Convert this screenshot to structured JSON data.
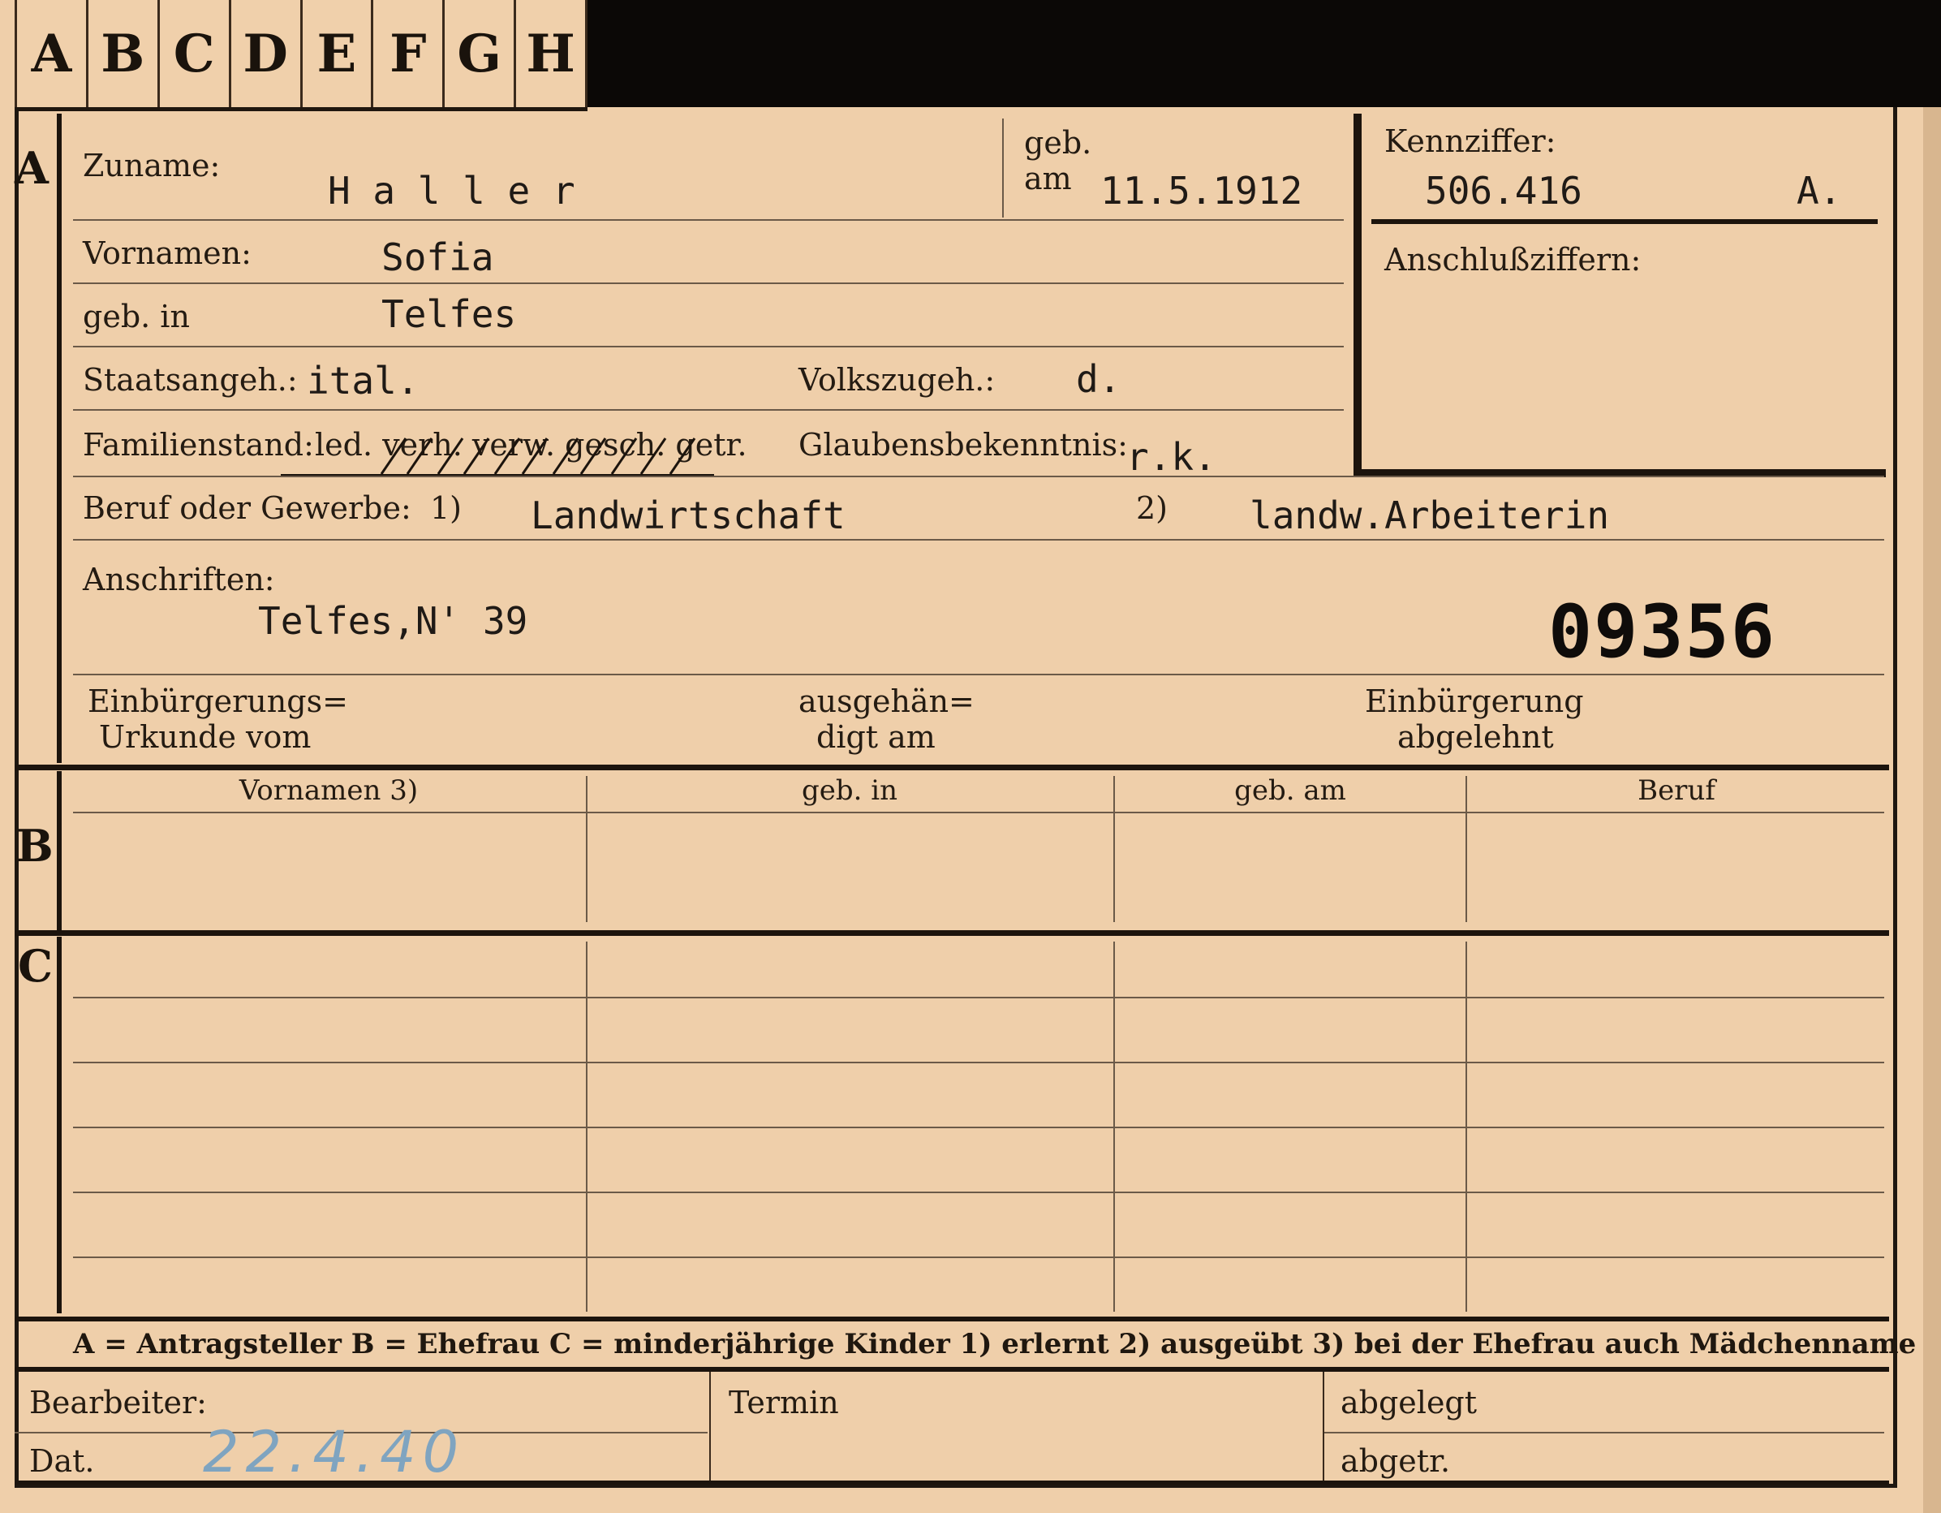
{
  "tabs": [
    "A",
    "B",
    "C",
    "D",
    "E",
    "F",
    "G",
    "H"
  ],
  "section_a": {
    "marker": "A",
    "zuname_label": "Zuname:",
    "zuname_value": "H a l l e r",
    "geb_label": "geb.",
    "am_label": "am",
    "geb_am_value": "11.5.1912",
    "kennziffer_label": "Kennziffer:",
    "kennziffer_value": "506.416",
    "kennziffer_suffix": "A.",
    "anschluss_label": "Anschlußziffern:",
    "vornamen_label": "Vornamen:",
    "vornamen_value": "Sofia",
    "geb_in_label": "geb. in",
    "geb_in_value": "Telfes",
    "staatsangeh_label": "Staatsangeh.:",
    "staatsangeh_value": "ital.",
    "volkszugeh_label": "Volkszugeh.:",
    "volkszugeh_value": "d.",
    "familienstand_label": "Familienstand:",
    "familienstand_options": "led. verh. verw. gesch. getr.",
    "glauben_label": "Glaubensbekenntnis:",
    "glauben_value": "r.k.",
    "beruf_label": "Beruf oder Gewerbe:",
    "beruf_note1": "1)",
    "beruf_value1": "Landwirtschaft",
    "beruf_note2": "2)",
    "beruf_value2": "landw.Arbeiterin",
    "anschriften_label": "Anschriften:",
    "anschriften_value": "Telfes,N' 39",
    "stamp_number": "09356",
    "einb_label_1": "Einbürgerungs=",
    "einb_label_2": "Urkunde vom",
    "ausgeh_label_1": "ausgehän=",
    "ausgeh_label_2": "digt am",
    "abgelehnt_label_1": "Einbürgerung",
    "abgelehnt_label_2": "abgelehnt"
  },
  "section_b": {
    "marker": "B",
    "columns": [
      "Vornamen 3)",
      "geb. in",
      "geb. am",
      "Beruf"
    ]
  },
  "section_c": {
    "marker": "C"
  },
  "legend": "A = Antragsteller   B = Ehefrau   C = minderjährige Kinder   1) erlernt   2) ausgeübt   3) bei der Ehefrau auch Mädchenname",
  "footer": {
    "bearbeiter_label": "Bearbeiter:",
    "dat_label": "Dat.",
    "dat_value": "22.4.40",
    "termin_label": "Termin",
    "abgelegt_label": "abgelegt",
    "abgetr_label": "abgetr."
  }
}
